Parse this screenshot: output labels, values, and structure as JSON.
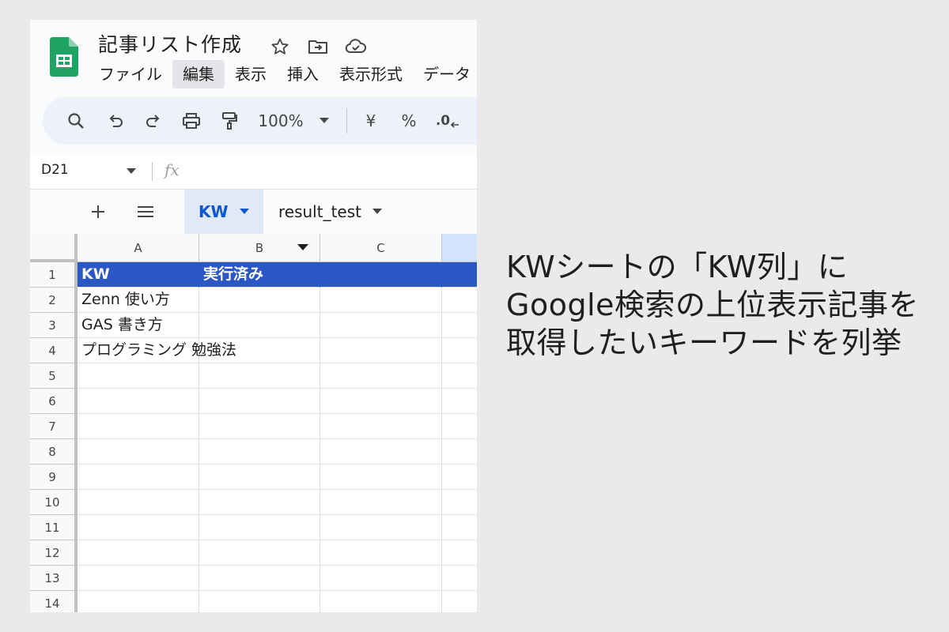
{
  "doc_title": "記事リスト作成",
  "menu": [
    "ファイル",
    "編集",
    "表示",
    "挿入",
    "表示形式",
    "データ"
  ],
  "menu_active_index": 1,
  "toolbar": {
    "zoom": "100%",
    "currency": "¥",
    "percent": "%",
    "decimal": ".0"
  },
  "formula_bar": {
    "cell_ref": "D21",
    "fx_label": "fx",
    "value": ""
  },
  "sheet_tabs": [
    {
      "label": "KW",
      "active": true
    },
    {
      "label": "result_test",
      "active": false
    }
  ],
  "columns": [
    "A",
    "B",
    "C"
  ],
  "rows": [
    {
      "num": "1",
      "cells": [
        "KW",
        "実行済み",
        ""
      ]
    },
    {
      "num": "2",
      "cells": [
        "Zenn 使い方",
        "",
        ""
      ]
    },
    {
      "num": "3",
      "cells": [
        "GAS 書き方",
        "",
        ""
      ]
    },
    {
      "num": "4",
      "cells": [
        "プログラミング 勉強法",
        "",
        ""
      ]
    },
    {
      "num": "5",
      "cells": [
        "",
        "",
        ""
      ]
    },
    {
      "num": "6",
      "cells": [
        "",
        "",
        ""
      ]
    },
    {
      "num": "7",
      "cells": [
        "",
        "",
        ""
      ]
    },
    {
      "num": "8",
      "cells": [
        "",
        "",
        ""
      ]
    },
    {
      "num": "9",
      "cells": [
        "",
        "",
        ""
      ]
    },
    {
      "num": "10",
      "cells": [
        "",
        "",
        ""
      ]
    },
    {
      "num": "11",
      "cells": [
        "",
        "",
        ""
      ]
    },
    {
      "num": "12",
      "cells": [
        "",
        "",
        ""
      ]
    },
    {
      "num": "13",
      "cells": [
        "",
        "",
        ""
      ]
    },
    {
      "num": "14",
      "cells": [
        "",
        "",
        ""
      ]
    }
  ],
  "caption": [
    "KWシートの「KW列」に",
    "Google検索の上位表示記事を",
    "取得したいキーワードを列挙"
  ],
  "colors": {
    "header_fill": "#2a56c6",
    "sheets_green": "#0f9d58",
    "active_tab": "#0b57d0"
  }
}
